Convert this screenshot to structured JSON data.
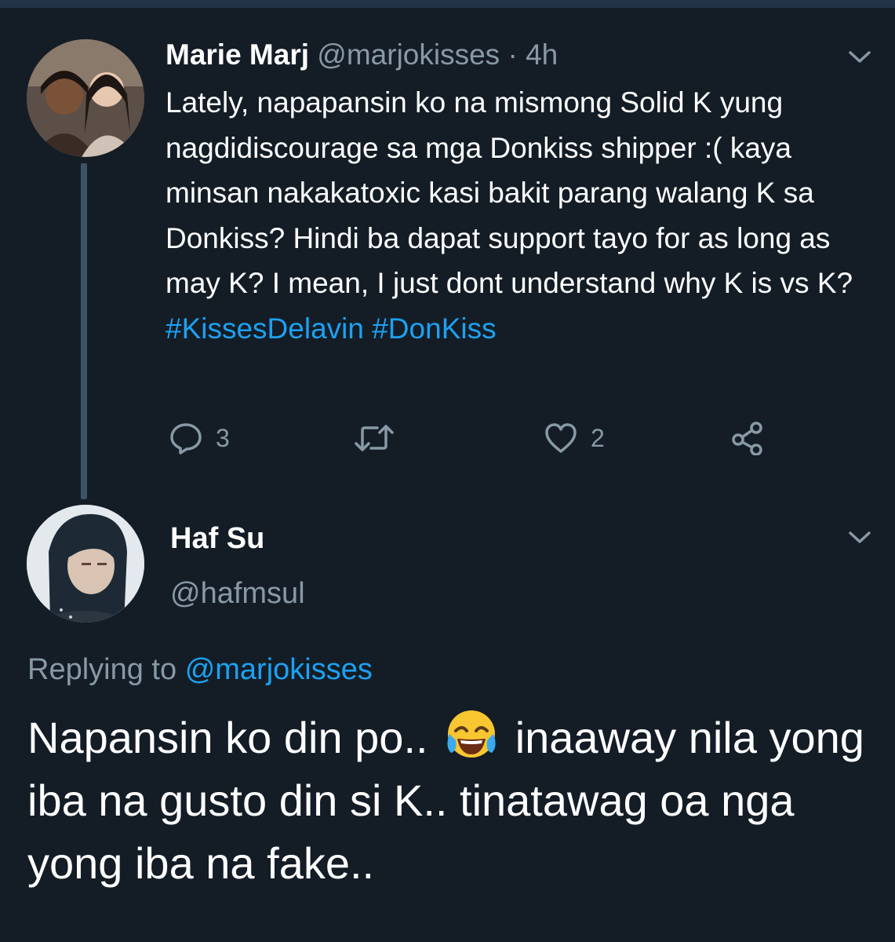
{
  "colors": {
    "background": "#141d26",
    "text": "#ffffff",
    "secondary": "#8899a6",
    "link": "#1da1f2",
    "thread_line": "#3d5466"
  },
  "parent_tweet": {
    "name": "Marie Marj",
    "handle": "@marjokisses",
    "separator": "·",
    "time": "4h",
    "body": "Lately, napapansin ko na mismong Solid K yung nagdidiscourage sa mga Donkiss shipper :( kaya minsan nakakatoxic kasi bakit parang walang K sa Donkiss? Hindi ba dapat support tayo for as long as may K? I mean, I just dont understand why K is vs K?",
    "hashtags": [
      "#KissesDelavin",
      "#DonKiss"
    ],
    "reply_count": "3",
    "like_count": "2",
    "icons": [
      "reply-icon",
      "retweet-icon",
      "like-icon",
      "share-icon",
      "chevron-down-icon"
    ]
  },
  "reply_tweet": {
    "name": "Haf Su",
    "handle": "@hafmsul",
    "replying_prefix": "Replying to",
    "replying_to": "@marjokisses",
    "body_part1": "Napansin ko din po..",
    "emoji": "face-with-tears-of-joy",
    "body_part2": "inaaway nila yong iba na gusto din si K.. tinatawag oa nga yong iba na fake.."
  }
}
